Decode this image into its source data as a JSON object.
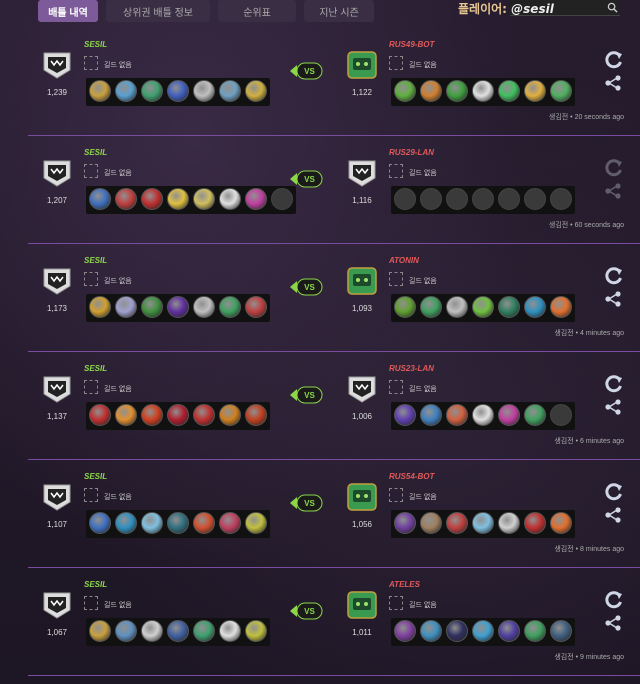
{
  "nav": {
    "tabs": [
      {
        "label": "배틀 내역",
        "active": true
      },
      {
        "label": "상위권 배틀 정보",
        "active": false
      },
      {
        "label": "순위표",
        "active": false
      },
      {
        "label": "지난 시즌",
        "active": false
      }
    ],
    "player_prefix": "플레이어:",
    "player_handle": "@sesil"
  },
  "battles": [
    {
      "left": {
        "name": "SESIL",
        "rating": "1,239",
        "guild": "길드 없음",
        "units": [
          "#c8a040",
          "#5aa0d0",
          "#40a070",
          "#4060c0",
          "#c0c0c0",
          "#70a0c0",
          "#d0b040"
        ]
      },
      "right": {
        "name": "RUS49-BOT",
        "rating": "1,122",
        "guild": "길드 없음",
        "units": [
          "#60b040",
          "#d08030",
          "#40a040",
          "#e0e0e0",
          "#40c060",
          "#e0b040",
          "#50b060"
        ]
      },
      "vs": "VS",
      "time": "생김전 • 20 seconds ago"
    },
    {
      "left": {
        "name": "SESIL",
        "rating": "1,207",
        "guild": "길드 없음",
        "units": [
          "#4070c0",
          "#c04040",
          "#c03030",
          "#e0c040",
          "#d0c060",
          "#e0e0e0",
          "#c040a0",
          "empty"
        ]
      },
      "right": {
        "name": "RUS29-LAN",
        "rating": "1,116",
        "guild": "길드 없음",
        "units": [
          "empty",
          "empty",
          "empty",
          "empty",
          "empty",
          "empty",
          "empty"
        ]
      },
      "vs": "VS",
      "time": "생김전 • 60 seconds ago"
    },
    {
      "left": {
        "name": "SESIL",
        "rating": "1,173",
        "guild": "길드 없음",
        "units": [
          "#d0a030",
          "#a0a0d0",
          "#409040",
          "#6030a0",
          "#c0c0c0",
          "#40a060",
          "#c04040"
        ]
      },
      "right": {
        "name": "ATONIN",
        "rating": "1,093",
        "guild": "길드 없음",
        "units": [
          "#60a030",
          "#40a060",
          "#c0c0c0",
          "#70c040",
          "#308060",
          "#3090c0",
          "#e07030"
        ]
      },
      "vs": "VS",
      "time": "생김전 • 4 minutes ago"
    },
    {
      "left": {
        "name": "SESIL",
        "rating": "1,137",
        "guild": "길드 없음",
        "units": [
          "#c03030",
          "#e09030",
          "#d04020",
          "#b02030",
          "#c03030",
          "#d08020",
          "#c04020"
        ]
      },
      "right": {
        "name": "RUS23-LAN",
        "rating": "1,006",
        "guild": "길드 없음",
        "units": [
          "#6040b0",
          "#4080c0",
          "#d06040",
          "#e0e0e0",
          "#c040a0",
          "#40a060",
          "empty"
        ]
      },
      "vs": "VS",
      "time": "생김전 • 6 minutes ago"
    },
    {
      "left": {
        "name": "SESIL",
        "rating": "1,107",
        "guild": "길드 없음",
        "units": [
          "#4070c0",
          "#3090c0",
          "#80c0e0",
          "#307080",
          "#d05030",
          "#c04060",
          "#c0c040"
        ]
      },
      "right": {
        "name": "RUS54-BOT",
        "rating": "1,056",
        "guild": "길드 없음",
        "units": [
          "#7040a0",
          "#a08060",
          "#c04040",
          "#80c0e0",
          "#d0d0d0",
          "#c03030",
          "#e07030"
        ]
      },
      "vs": "VS",
      "time": "생김전 • 8 minutes ago"
    },
    {
      "left": {
        "name": "SESIL",
        "rating": "1,067",
        "guild": "길드 없음",
        "units": [
          "#c8a040",
          "#6090c0",
          "#d0d0d0",
          "#4060a0",
          "#40a070",
          "#e0e0e0",
          "#c0c040"
        ]
      },
      "right": {
        "name": "ATELES",
        "rating": "1,011",
        "guild": "길드 없음",
        "units": [
          "#8040a0",
          "#4090c0",
          "#303060",
          "#40a0d0",
          "#5040a0",
          "#40a060",
          "#406080"
        ]
      },
      "vs": "VS",
      "time": "생김전 • 9 minutes ago"
    }
  ],
  "colors": {
    "accent": "#7d5a9a",
    "my_name": "#8cd648",
    "opp_name": "#e05a5a",
    "separator": "#7a4ca0",
    "vs_green": "#8cd648"
  },
  "icons": {
    "badge": "shield-badge-icon",
    "opponent_avatar": "robot-avatar-icon",
    "guild": "guild-placeholder-icon",
    "refresh": "refresh-icon",
    "share": "share-icon",
    "search": "search-icon"
  }
}
